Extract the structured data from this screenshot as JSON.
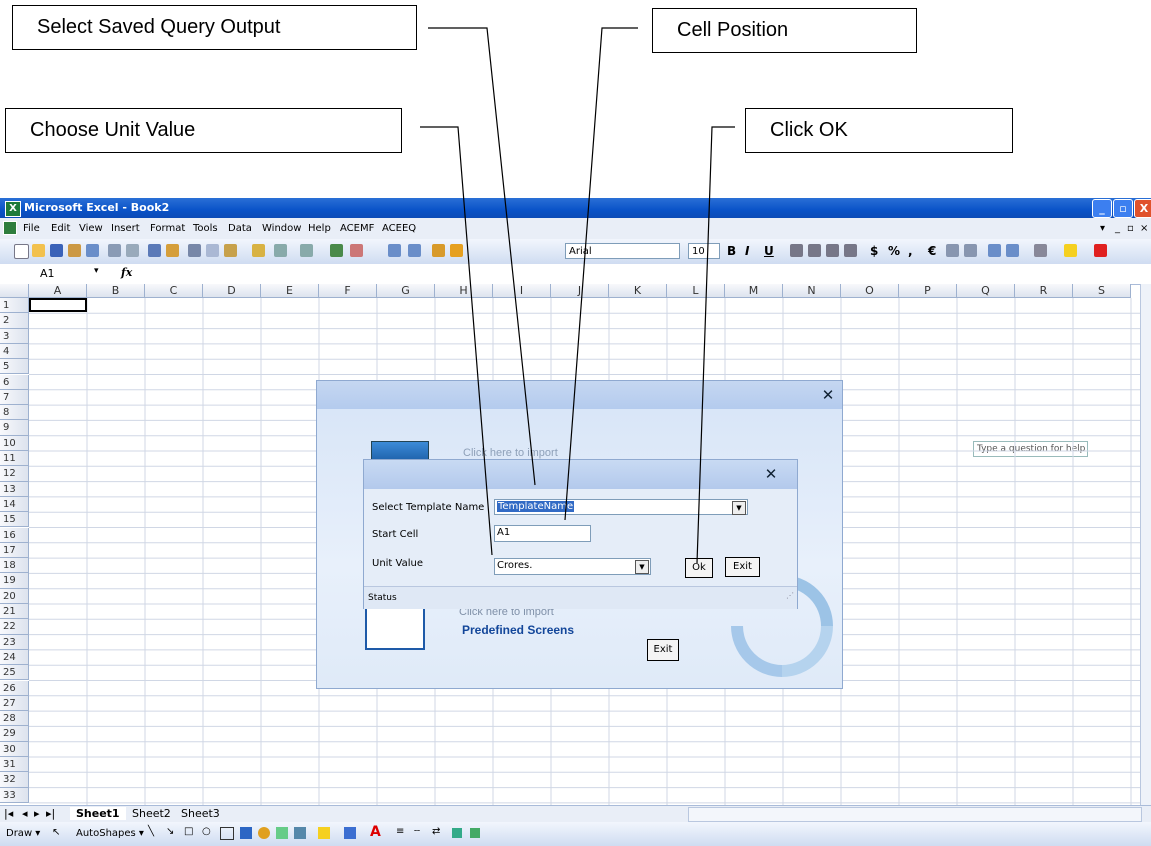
{
  "callouts": {
    "select_saved": "Select Saved Query Output",
    "cell_position": "Cell Position",
    "choose_unit": "Choose Unit Value",
    "click_ok": "Click OK"
  },
  "window": {
    "title": "Microsoft Excel - Book2",
    "icon_label": "X",
    "min": "_",
    "restore": "▫",
    "close": "X"
  },
  "menu": [
    "File",
    "Edit",
    "View",
    "Insert",
    "Format",
    "Tools",
    "Data",
    "Window",
    "Help",
    "ACEMF",
    "ACEEQ"
  ],
  "help_box": "Type a question for help",
  "toolbar": {
    "font_name": "Arial",
    "font_size": "10",
    "bold": "B",
    "italic": "I",
    "underline": "U",
    "currency": "$",
    "percent": "%",
    "comma": ",",
    "euro": "€"
  },
  "formula": {
    "name_box": "A1",
    "fx": "fx"
  },
  "grid": {
    "columns": [
      "A",
      "B",
      "C",
      "D",
      "E",
      "F",
      "G",
      "H",
      "I",
      "J",
      "K",
      "L",
      "M",
      "N",
      "O",
      "P",
      "Q",
      "R",
      "S"
    ],
    "rows": [
      "1",
      "2",
      "3",
      "4",
      "5",
      "6",
      "7",
      "8",
      "9",
      "10",
      "11",
      "12",
      "13",
      "14",
      "15",
      "16",
      "17",
      "18",
      "19",
      "20",
      "21",
      "22",
      "23",
      "24",
      "25",
      "26",
      "27",
      "28",
      "29",
      "30",
      "31",
      "32",
      "33"
    ]
  },
  "sheet_tabs": [
    "Sheet1",
    "Sheet2",
    "Sheet3"
  ],
  "draw_bar": {
    "draw": "Draw ▾",
    "autoshapes": "AutoShapes ▾"
  },
  "import_dialog": {
    "import_text_1": "Click here to import",
    "import_text_2": "Click here to import",
    "predefined": "Predefined Screens",
    "exit": "Exit",
    "close": "✕"
  },
  "template_dialog": {
    "close": "✕",
    "template_label": "Select Template Name",
    "template_value": "TemplateName",
    "start_cell_label": "Start Cell",
    "start_cell_value": "A1",
    "unit_label": "Unit Value",
    "unit_value": "Crores.",
    "ok": "Ok",
    "exit": "Exit",
    "status_label": "Status"
  }
}
